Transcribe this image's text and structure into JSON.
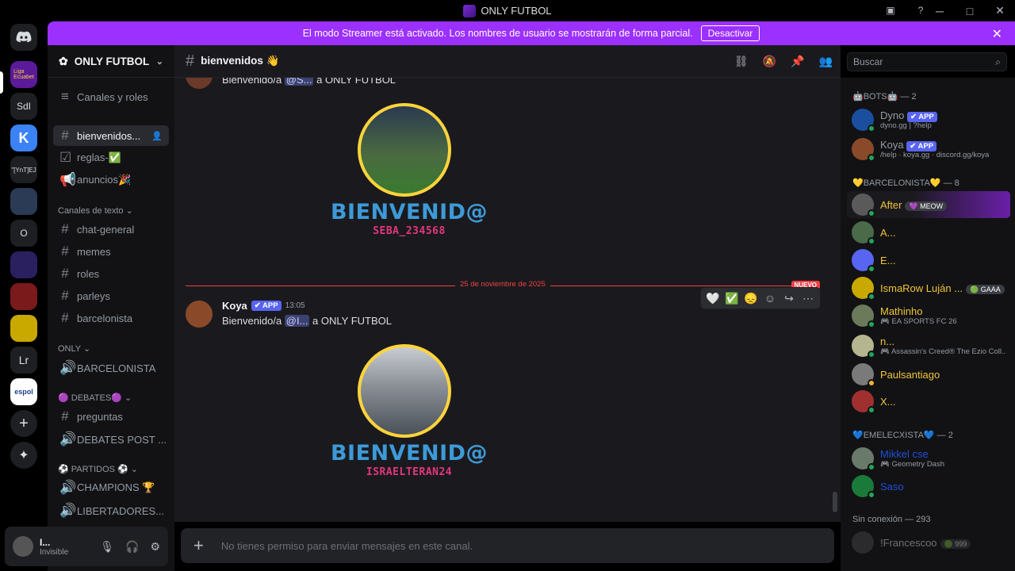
{
  "window": {
    "title": "ONLY FUTBOL"
  },
  "streamer_bar": {
    "text": "El modo Streamer está activado. Los nombres de usuario se mostrarán de forma parcial.",
    "button": "Desactivar"
  },
  "servers": [
    "SdI",
    "\"[YnT]EJ",
    "O",
    "Lr",
    "espol"
  ],
  "guild": {
    "name": "ONLY FUTBOL"
  },
  "sidebar": {
    "channels_roles": "Canales y roles",
    "top": [
      {
        "label": "bienvenidos..."
      },
      {
        "label": "reglas-✅"
      },
      {
        "label": "anuncios🎉"
      }
    ],
    "cat_text": "Canales de texto ⌄",
    "text": [
      {
        "label": "chat-general"
      },
      {
        "label": "memes"
      },
      {
        "label": "roles"
      },
      {
        "label": "parleys"
      },
      {
        "label": "barcelonista"
      }
    ],
    "cat_only": "ONLY ⌄",
    "only": [
      {
        "label": "BARCELONISTA"
      }
    ],
    "cat_debates": "🟣 DEBATES🟣 ⌄",
    "debates": [
      {
        "label": "preguntas"
      },
      {
        "label": "DEBATES POST ..."
      }
    ],
    "cat_partidos": "⚽ PARTIDOS ⚽ ⌄",
    "partidos": [
      {
        "label": "CHAMPIONS 🏆"
      },
      {
        "label": "LIBERTADORES..."
      }
    ]
  },
  "user": {
    "name": "I...",
    "status": "Invisible"
  },
  "header": {
    "channel": "bienvenidos 👋",
    "search": "Buscar"
  },
  "messages": {
    "m1": {
      "pre": "Bienvenido/a ",
      "mention": "@S...",
      "post": " a ONLY FUTBOL"
    },
    "w1": {
      "title": "BIENVENID@",
      "user": "SEBA_234568"
    },
    "divider": {
      "date": "25 de noviembre de 2025",
      "new": "NUEVO"
    },
    "m2": {
      "author": "Koya",
      "badge": "✔ APP",
      "time": "13:05",
      "pre": "Bienvenido/a ",
      "mention": "@I...",
      "post": " a ONLY FUTBOL"
    },
    "w2": {
      "title": "BIENVENID@",
      "user": "ISRAELTERAN24"
    }
  },
  "composer": {
    "placeholder": "No tienes permiso para enviar mensajes en este canal."
  },
  "members": {
    "bots": {
      "title": "🤖BOTS🤖 — 2",
      "items": [
        {
          "name": "Dyno",
          "badge": "✔ APP",
          "activity": "dyno.gg | ?help"
        },
        {
          "name": "Koya",
          "badge": "✔ APP",
          "activity": "/help · koya.gg · discord.gg/koya"
        }
      ]
    },
    "barcelonista": {
      "title": "💛BARCELONISTA💛 — 8",
      "items": [
        {
          "name": "After",
          "tag": "💜 MEOW"
        },
        {
          "name": "A..."
        },
        {
          "name": "E..."
        },
        {
          "name": "IsmaRow Luján ...",
          "tag": "🟢 GAAA"
        },
        {
          "name": "Mathinho",
          "activity": "🎮 EA SPORTS FC 26"
        },
        {
          "name": "n...",
          "activity": "🎮 Assassin's Creed® The Ezio Coll..."
        },
        {
          "name": "Paulsantiago"
        },
        {
          "name": "X..."
        }
      ]
    },
    "emelec": {
      "title": "💙EMELECXISTA💙 — 2",
      "items": [
        {
          "name": "Mikkel cse",
          "activity": "🎮 Geometry Dash"
        },
        {
          "name": "Saso"
        }
      ]
    },
    "offline": {
      "title": "Sin conexión — 293",
      "items": [
        {
          "name": "!Francescoo",
          "tag": "🟢 999"
        }
      ]
    }
  },
  "colors": {
    "accent": "#9b30ff",
    "barcelonista": "#f0c43a",
    "emelec": "#1f4fd6",
    "online": "#23a55a",
    "unread": "#f23f43"
  }
}
